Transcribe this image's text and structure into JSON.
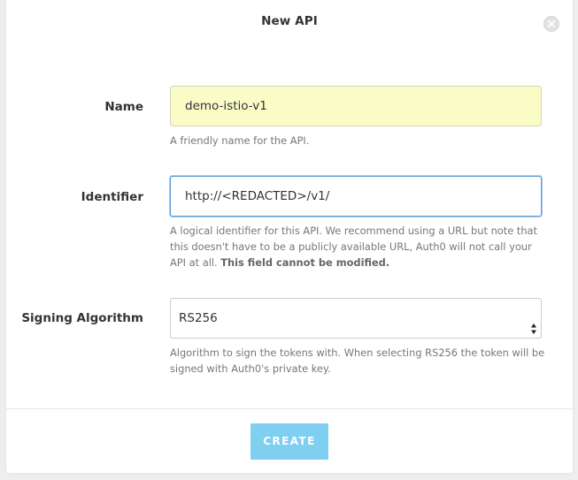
{
  "dialog": {
    "title": "New API",
    "close_icon": "close-icon"
  },
  "form": {
    "name": {
      "label": "Name",
      "value": "demo-istio-v1",
      "help": "A friendly name for the API."
    },
    "identifier": {
      "label": "Identifier",
      "value": "http://<REDACTED>/v1/",
      "help_line1": "A logical identifier for this API. We recommend using a URL but note that",
      "help_line2": "this doesn't have to be a publicly available URL, Auth0 will not call your",
      "help_line3": "API at all.",
      "help_bold": "This field cannot be modified."
    },
    "signing_algorithm": {
      "label": "Signing Algorithm",
      "selected": "RS256",
      "help_line1": "Algorithm to sign the tokens with. When selecting RS256 the token will be",
      "help_line2": "signed with Auth0's private key."
    }
  },
  "footer": {
    "create_label": "CREATE"
  },
  "colors": {
    "create_button": "#7ecff0",
    "name_field_bg": "#fafcc8",
    "focus_border": "#5b9bd5"
  }
}
